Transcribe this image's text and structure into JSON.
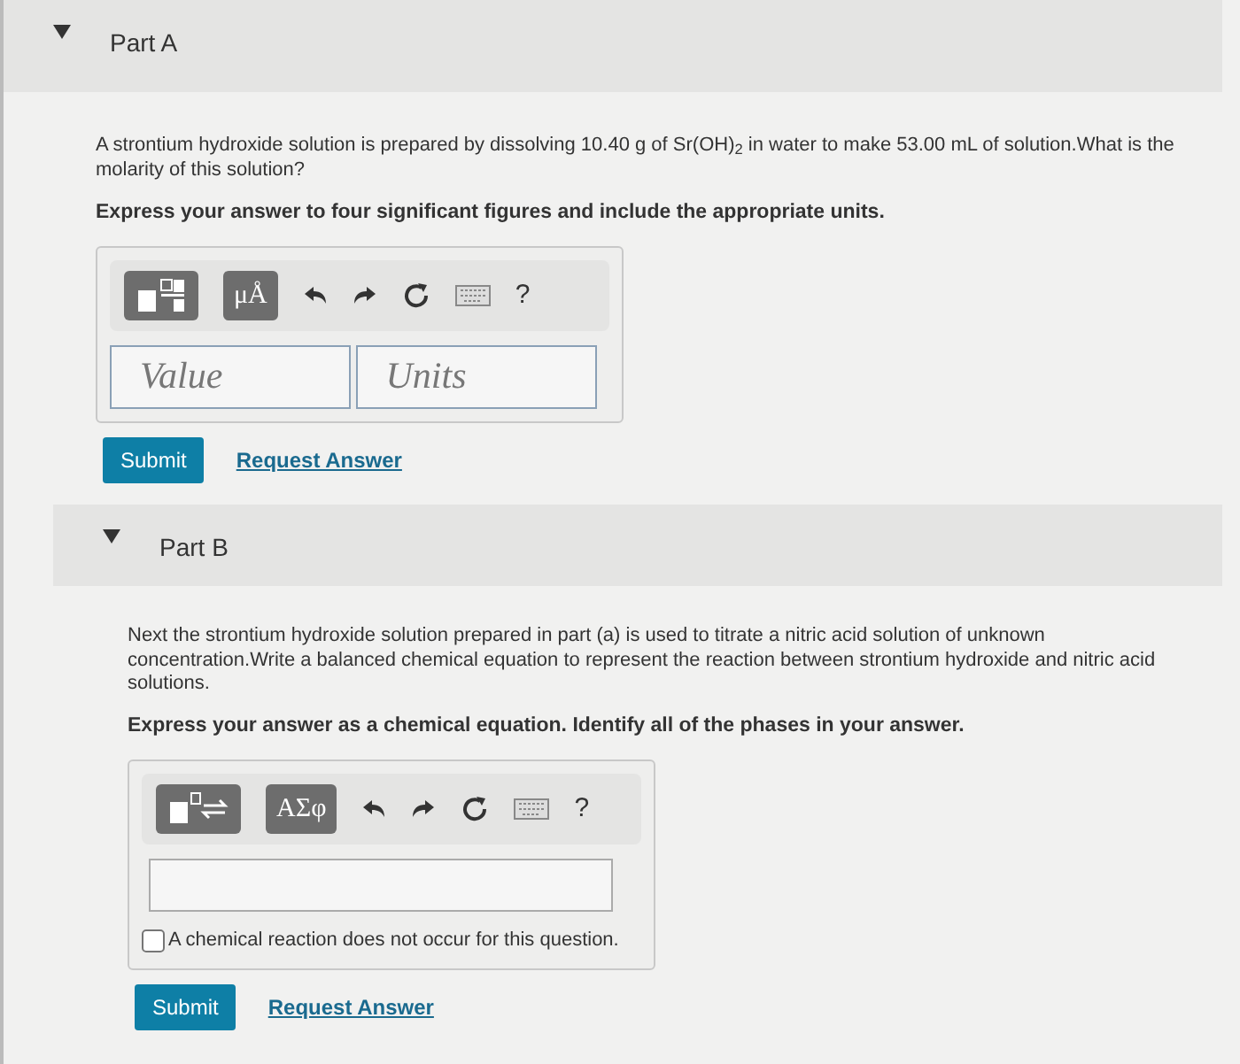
{
  "parts": [
    {
      "title": "Part A",
      "expanded": true,
      "question": "A strontium hydroxide solution is prepared by dissolving 10.40 g of Sr(OH)$_{2}$ in water to make 53.00 mL of solution.What is the molarity of this solution?",
      "instruction": "Express your answer to four significant figures and include the appropriate units.",
      "toolbar": [
        {
          "kind": "template"
        },
        {
          "kind": "symbols",
          "label": "μÅ"
        },
        {
          "kind": "undo"
        },
        {
          "kind": "redo"
        },
        {
          "kind": "reset"
        },
        {
          "kind": "keyboard"
        },
        {
          "kind": "help",
          "label": "?"
        }
      ],
      "answer": {
        "kind": "value_units",
        "value_placeholder": "Value",
        "units_placeholder": "Units"
      },
      "buttons": {
        "submit": "Submit",
        "request": "Request Answer"
      }
    },
    {
      "title": "Part B",
      "expanded": true,
      "question": "Next the strontium hydroxide solution prepared in part (a) is used to titrate a nitric acid solution of unknown concentration.Write a balanced chemical equation to represent the reaction between strontium hydroxide and nitric acid solutions.",
      "instruction": "Express your answer as a chemical equation. Identify all of the phases in your answer.",
      "toolbar": [
        {
          "kind": "reaction"
        },
        {
          "kind": "symbols",
          "label": "ΑΣφ"
        },
        {
          "kind": "undo"
        },
        {
          "kind": "redo"
        },
        {
          "kind": "reset"
        },
        {
          "kind": "keyboard"
        },
        {
          "kind": "help",
          "label": "?"
        }
      ],
      "answer": {
        "kind": "equation",
        "checkbox_label": "A chemical reaction does not occur for this question.",
        "checked": false
      },
      "buttons": {
        "submit": "Submit",
        "request": "Request Answer"
      }
    }
  ]
}
